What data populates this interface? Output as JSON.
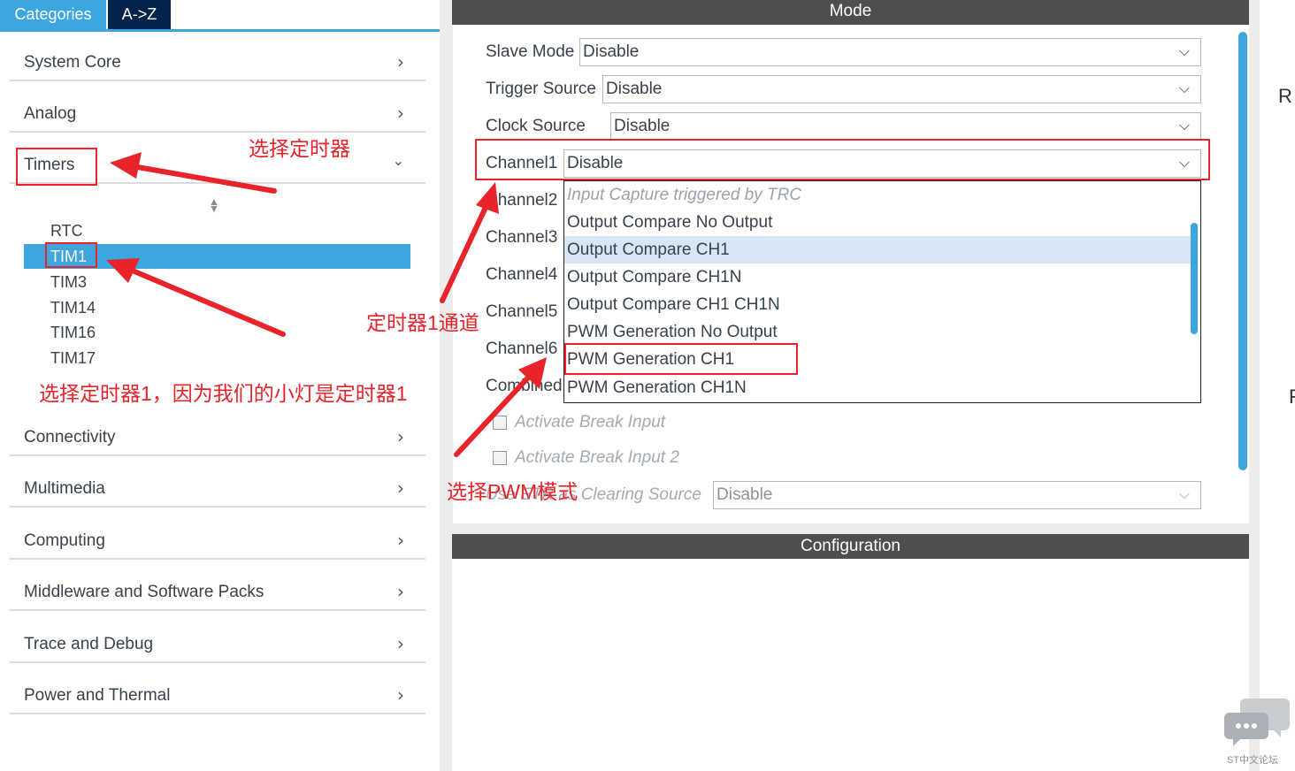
{
  "tabs": {
    "categories": "Categories",
    "az": "A->Z"
  },
  "categories": {
    "system_core": "System Core",
    "analog": "Analog",
    "timers": "Timers",
    "connectivity": "Connectivity",
    "multimedia": "Multimedia",
    "computing": "Computing",
    "middleware": "Middleware and Software Packs",
    "trace": "Trace and Debug",
    "power": "Power and Thermal"
  },
  "timers_list": [
    "RTC",
    "TIM1",
    "TIM3",
    "TIM14",
    "TIM16",
    "TIM17"
  ],
  "selected_timer": "TIM1",
  "mode": {
    "header": "Mode",
    "slave_mode_label": "Slave Mode",
    "slave_mode_value": "Disable",
    "trigger_source_label": "Trigger Source",
    "trigger_source_value": "Disable",
    "clock_source_label": "Clock Source",
    "clock_source_value": "Disable",
    "channel1_label": "Channel1",
    "channel1_value": "Disable",
    "channel2_label": "Channel2",
    "channel3_label": "Channel3",
    "channel4_label": "Channel4",
    "channel5_label": "Channel5",
    "channel6_label": "Channel6",
    "combined_label": "Combined",
    "break_input": "Activate Break Input",
    "break_input2": "Activate Break Input 2",
    "etr_label": "Use ETR as Clearing Source",
    "etr_value": "Disable"
  },
  "dropdown_options": [
    "Input Capture triggered by TRC",
    "Output Compare No Output",
    "Output Compare CH1",
    "Output Compare CH1N",
    "Output Compare CH1 CH1N",
    "PWM Generation No Output",
    "PWM Generation CH1",
    "PWM Generation CH1N"
  ],
  "configuration": {
    "header": "Configuration"
  },
  "annotations": {
    "select_timer": "选择定时器",
    "timer1_channel": "定时器1通道",
    "select_tim1_reason": "选择定时器1，因为我们的小灯是定时器1",
    "select_pwm": "选择PWM模式"
  },
  "edge_text": {
    "r": "R",
    "p": "F"
  },
  "watermark": "ST中文论坛",
  "colors": {
    "accent": "#3ea6de",
    "dark_tab": "#03234b",
    "annotation_red": "#e8232a",
    "header_gray": "#4e4e4e"
  }
}
